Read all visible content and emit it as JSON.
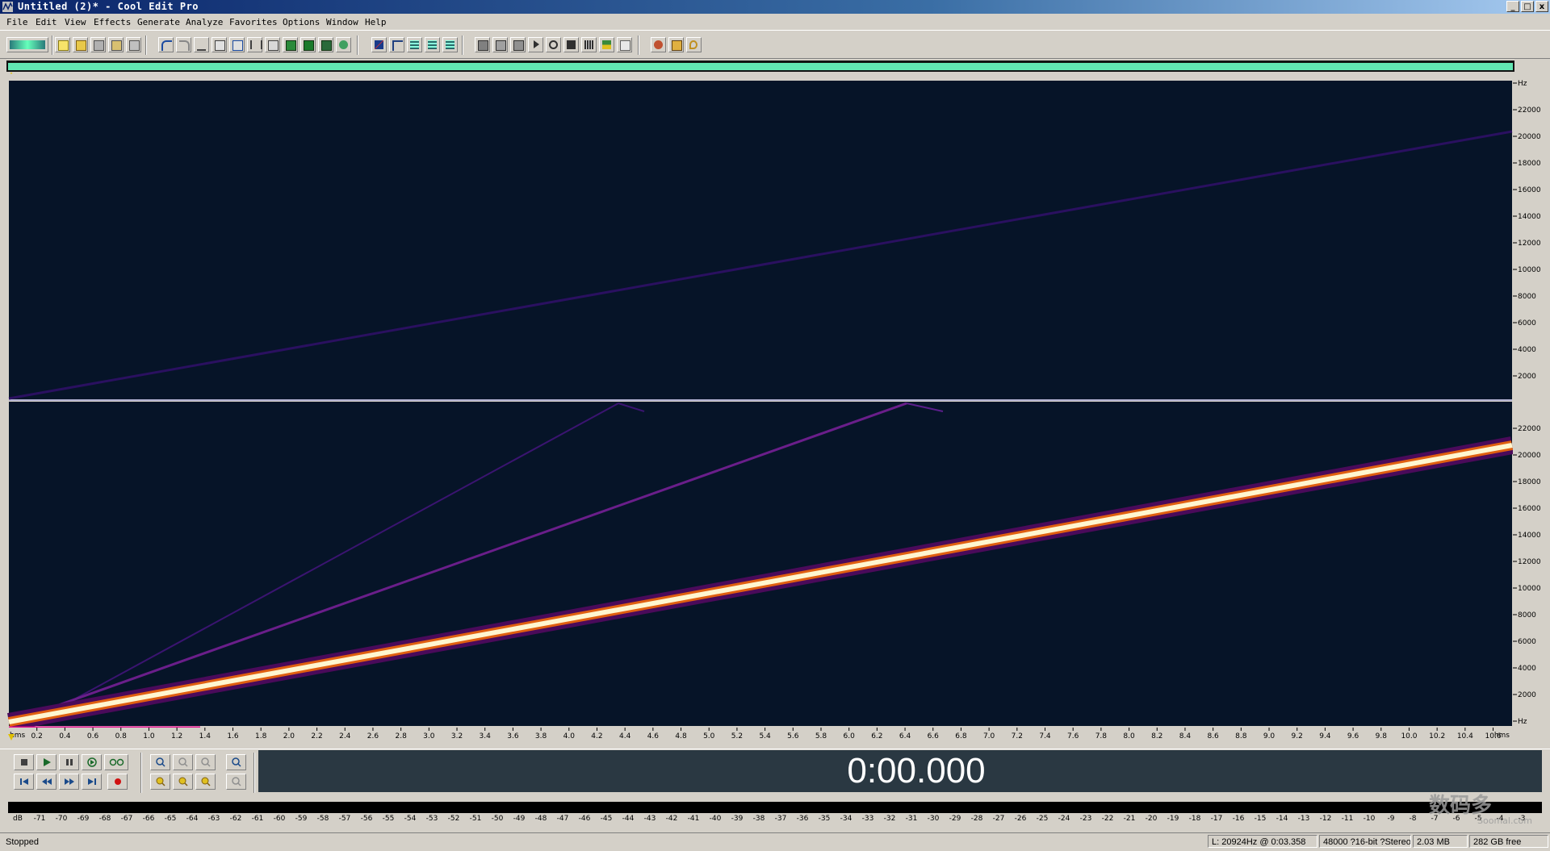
{
  "window": {
    "title": "Untitled (2)* - Cool Edit Pro",
    "controls": [
      "_",
      "□",
      "x"
    ]
  },
  "menu": [
    "File",
    "Edit",
    "View",
    "Effects",
    "Generate",
    "Analyze",
    "Favorites",
    "Options",
    "Window",
    "Help"
  ],
  "spectrogram": {
    "top_channel_freq_labels": [
      "Hz",
      "22000",
      "20000",
      "18000",
      "16000",
      "14000",
      "12000",
      "10000",
      "8000",
      "6000",
      "4000",
      "2000"
    ],
    "bottom_channel_freq_labels": [
      "22000",
      "20000",
      "18000",
      "16000",
      "14000",
      "12000",
      "10000",
      "8000",
      "6000",
      "4000",
      "2000",
      "Hz"
    ],
    "time_unit_left": "hms",
    "time_unit_right": "hms",
    "time_ticks": [
      "0.2",
      "0.4",
      "0.6",
      "0.8",
      "1.0",
      "1.2",
      "1.4",
      "1.6",
      "1.8",
      "2.0",
      "2.2",
      "2.4",
      "2.6",
      "2.8",
      "3.0",
      "3.2",
      "3.4",
      "3.6",
      "3.8",
      "4.0",
      "4.2",
      "4.4",
      "4.6",
      "4.8",
      "5.0",
      "5.2",
      "5.4",
      "5.6",
      "5.8",
      "6.0",
      "6.2",
      "6.4",
      "6.6",
      "6.8",
      "7.0",
      "7.2",
      "7.4",
      "7.6",
      "7.8",
      "8.0",
      "8.2",
      "8.4",
      "8.6",
      "8.8",
      "9.0",
      "9.2",
      "9.4",
      "9.6",
      "9.8",
      "10.0",
      "10.2",
      "10.4",
      "10.6"
    ],
    "colors": {
      "background": "#061428",
      "sweep": "#fff6d0",
      "harmonic": "#5a1e8a",
      "ruler_bg": "#1a2430"
    }
  },
  "transport": {
    "time": "0:00.000",
    "buttons": [
      "stop-icon",
      "play-icon",
      "pause-icon",
      "play-to-end-icon",
      "loop-icon",
      "go-to-start-icon",
      "rewind-icon",
      "fast-forward-icon",
      "go-to-end-icon",
      "record-icon"
    ],
    "zoom_buttons": [
      "zoom-in-icon",
      "zoom-out-icon",
      "zoom-full-icon",
      "zoom-vertical-in-icon",
      "zoom-left-icon",
      "zoom-selection-icon",
      "zoom-right-icon",
      "zoom-vertical-out-icon"
    ]
  },
  "level_meter": {
    "scale": [
      "dB",
      "-71",
      "-70",
      "-69",
      "-68",
      "-67",
      "-66",
      "-65",
      "-64",
      "-63",
      "-62",
      "-61",
      "-60",
      "-59",
      "-58",
      "-57",
      "-56",
      "-55",
      "-54",
      "-53",
      "-52",
      "-51",
      "-50",
      "-49",
      "-48",
      "-47",
      "-46",
      "-45",
      "-44",
      "-43",
      "-42",
      "-41",
      "-40",
      "-39",
      "-38",
      "-37",
      "-36",
      "-35",
      "-34",
      "-33",
      "-32",
      "-31",
      "-30",
      "-29",
      "-28",
      "-27",
      "-26",
      "-25",
      "-24",
      "-23",
      "-22",
      "-21",
      "-20",
      "-19",
      "-18",
      "-17",
      "-16",
      "-15",
      "-14",
      "-13",
      "-12",
      "-11",
      "-10",
      "-9",
      "-8",
      "-7",
      "-6",
      "-5",
      "-4",
      "-3"
    ]
  },
  "status": {
    "state": "Stopped",
    "cursor": "L: 20924Hz @   0:03.358",
    "format": "48000 ?16-bit ?Stereo",
    "size": "2.03 MB",
    "free": "282 GB free"
  },
  "watermark": {
    "text": "数码多",
    "sub": "Soomal.com"
  }
}
